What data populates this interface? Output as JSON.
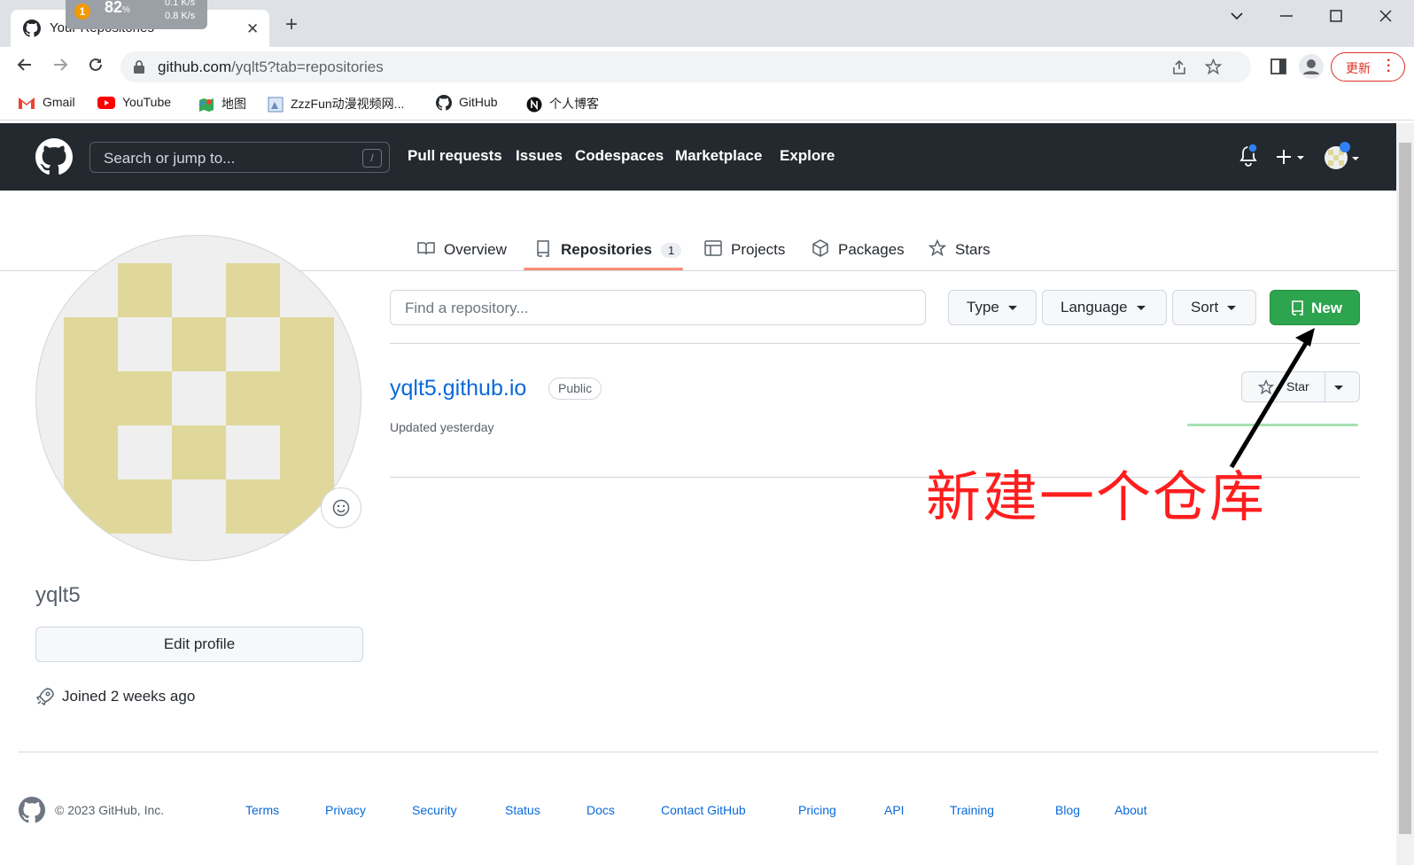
{
  "browser": {
    "tab_title": "Your Repositories",
    "netwidget": {
      "badge": "1",
      "percent": "82",
      "percent_unit": "%",
      "up": "0.1 K/s",
      "down": "0.8 K/s"
    },
    "url_host": "github.com",
    "url_path": "/yqlt5?tab=repositories",
    "update_label": "更新",
    "bookmarks": [
      "Gmail",
      "YouTube",
      "地图",
      "ZzzFun动漫视频网...",
      "GitHub",
      "个人博客"
    ]
  },
  "header": {
    "search_placeholder": "Search or jump to...",
    "search_shortcut": "/",
    "nav": [
      "Pull requests",
      "Issues",
      "Codespaces",
      "Marketplace",
      "Explore"
    ]
  },
  "profile_tabs": {
    "overview": "Overview",
    "repositories": "Repositories",
    "repositories_count": "1",
    "projects": "Projects",
    "packages": "Packages",
    "stars": "Stars"
  },
  "profile": {
    "username": "yqlt5",
    "edit_profile": "Edit profile",
    "joined": "Joined 2 weeks ago"
  },
  "repo_controls": {
    "find_placeholder": "Find a repository...",
    "type": "Type",
    "language": "Language",
    "sort": "Sort",
    "new": "New"
  },
  "repos": [
    {
      "name": "yqlt5.github.io",
      "visibility": "Public",
      "updated": "Updated yesterday",
      "star_label": "Star"
    }
  ],
  "annotation": "新建一个仓库",
  "footer": {
    "copyright": "© 2023 GitHub, Inc.",
    "links": [
      "Terms",
      "Privacy",
      "Security",
      "Status",
      "Docs",
      "Contact GitHub",
      "Pricing",
      "API",
      "Training",
      "Blog",
      "About"
    ]
  },
  "colors": {
    "github_header": "#24292f",
    "new_button": "#2da44e",
    "link": "#0969da",
    "annotation": "#ff1e1e",
    "tab_underline": "#fd8c73"
  }
}
